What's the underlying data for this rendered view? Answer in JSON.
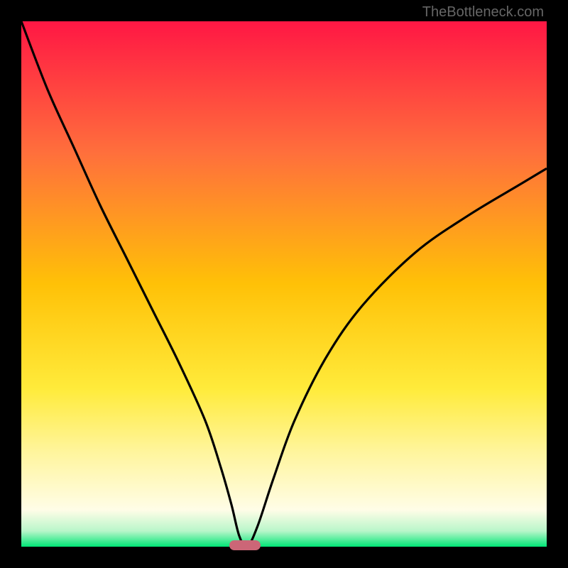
{
  "watermark": "TheBottleneck.com",
  "chart_data": {
    "type": "line",
    "title": "",
    "xlabel": "",
    "ylabel": "",
    "xlim": [
      0,
      100
    ],
    "ylim": [
      0,
      100
    ],
    "gradient_stops": [
      {
        "offset": 0,
        "color": "#ff1744"
      },
      {
        "offset": 25,
        "color": "#ff6f3c"
      },
      {
        "offset": 50,
        "color": "#ffc107"
      },
      {
        "offset": 70,
        "color": "#ffeb3b"
      },
      {
        "offset": 82,
        "color": "#fff59d"
      },
      {
        "offset": 93,
        "color": "#fffde7"
      },
      {
        "offset": 97,
        "color": "#b9f6ca"
      },
      {
        "offset": 100,
        "color": "#00e676"
      }
    ],
    "series": [
      {
        "name": "curve",
        "x": [
          0,
          5,
          10,
          15,
          20,
          25,
          30,
          35,
          38,
          40,
          41.5,
          43,
          45,
          48,
          52,
          58,
          65,
          75,
          85,
          95,
          100
        ],
        "y": [
          100,
          87,
          76,
          65,
          55,
          45,
          35,
          24,
          15,
          8,
          2,
          0,
          4,
          13,
          24,
          36,
          46,
          56,
          63,
          69,
          72
        ]
      }
    ],
    "marker": {
      "x": 42.5,
      "y": 0,
      "color": "#cc6677"
    }
  }
}
